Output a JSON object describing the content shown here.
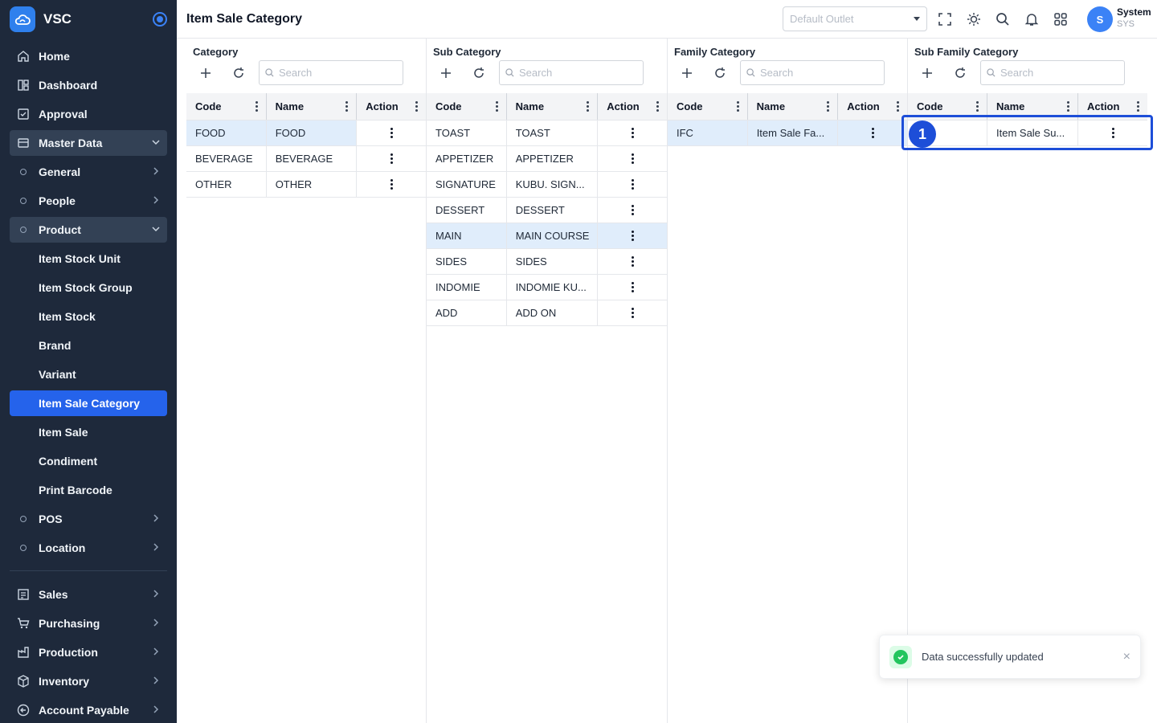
{
  "app": {
    "name": "VSC",
    "page_title": "Item Sale Category"
  },
  "header": {
    "outlet_placeholder": "Default Outlet",
    "user_name": "System",
    "user_code": "SYS",
    "avatar_initial": "S"
  },
  "sidebar": {
    "home": "Home",
    "dashboard": "Dashboard",
    "approval": "Approval",
    "master_data": "Master Data",
    "general": "General",
    "people": "People",
    "product": "Product",
    "product_items": [
      "Item Stock Unit",
      "Item Stock Group",
      "Item Stock",
      "Brand",
      "Variant",
      "Item Sale Category",
      "Item Sale",
      "Condiment",
      "Print Barcode"
    ],
    "pos": "POS",
    "location": "Location",
    "sales": "Sales",
    "purchasing": "Purchasing",
    "production": "Production",
    "inventory": "Inventory",
    "account_payable": "Account Payable"
  },
  "columns": {
    "code": "Code",
    "name": "Name",
    "action": "Action"
  },
  "search_placeholder": "Search",
  "panels": {
    "category": {
      "title": "Category",
      "rows": [
        {
          "code": "FOOD",
          "name": "FOOD"
        },
        {
          "code": "BEVERAGE",
          "name": "BEVERAGE"
        },
        {
          "code": "OTHER",
          "name": "OTHER"
        }
      ]
    },
    "sub_category": {
      "title": "Sub Category",
      "rows": [
        {
          "code": "TOAST",
          "name": "TOAST"
        },
        {
          "code": "APPETIZER",
          "name": "APPETIZER"
        },
        {
          "code": "SIGNATURE",
          "name": "KUBU. SIGN..."
        },
        {
          "code": "DESSERT",
          "name": "DESSERT"
        },
        {
          "code": "MAIN",
          "name": "MAIN COURSE"
        },
        {
          "code": "SIDES",
          "name": "SIDES"
        },
        {
          "code": "INDOMIE",
          "name": "INDOMIE KU..."
        },
        {
          "code": "ADD",
          "name": "ADD ON"
        }
      ]
    },
    "family_category": {
      "title": "Family Category",
      "rows": [
        {
          "code": "IFC",
          "name": "Item Sale Fa..."
        }
      ]
    },
    "sub_family_category": {
      "title": "Sub Family Category",
      "rows": [
        {
          "code": "",
          "name": "Item Sale Su..."
        }
      ]
    }
  },
  "annotation": {
    "badge": "1"
  },
  "toast": {
    "message": "Data successfully updated",
    "close": "×"
  }
}
